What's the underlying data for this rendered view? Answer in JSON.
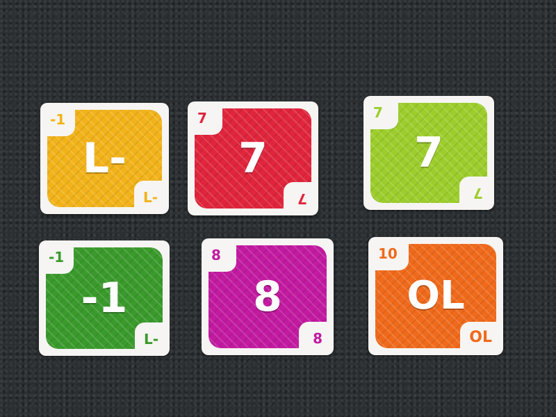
{
  "cards": [
    {
      "color": "#f2b31a",
      "top": "-1",
      "center": "L-",
      "bottom": "L-"
    },
    {
      "color": "#e0253c",
      "top": "7",
      "center": "7",
      "bottom": "7"
    },
    {
      "color": "#9ccd2c",
      "top": "7",
      "center": "7",
      "bottom": "7"
    },
    {
      "color": "#3a9a2c",
      "top": "-1",
      "center": "-1",
      "bottom": "L-"
    },
    {
      "color": "#c21aa0",
      "top": "8",
      "center": "8",
      "bottom": "8"
    },
    {
      "color": "#f06a1c",
      "top": "10",
      "center": "OL",
      "bottom": "OL"
    }
  ]
}
